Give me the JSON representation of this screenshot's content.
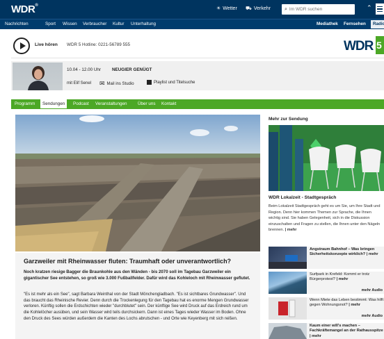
{
  "header": {
    "logo": "WDR",
    "weather": "Wetter",
    "traffic": "Verkehr",
    "search_placeholder": "Im WDR suchen",
    "nav_left": [
      "Nachrichten",
      "Sport",
      "Wissen",
      "Verbraucher",
      "Kultur",
      "Unterhaltung"
    ],
    "nav_right": [
      "Mediathek",
      "Fernsehen",
      "Radio"
    ]
  },
  "player": {
    "live_label": "Live hören",
    "hotline": "WDR 5 Hotline: 0221-56789 555",
    "station_text": "WDR",
    "station_number": "5"
  },
  "show": {
    "time": "10.04 - 12.00 Uhr",
    "name": "NEUGIER GENÜGT",
    "host": "mit Elif Senel",
    "mail": "Mail ins Studio",
    "playlist": "Playlist und Titelsuche"
  },
  "tabs": [
    "Programm",
    "Sendungen",
    "Podcast",
    "Veranstaltungen",
    "Über uns",
    "Kontakt"
  ],
  "article": {
    "title": "Garzweiler mit Rheinwasser fluten: Traumhaft oder unverantwortlich?",
    "lead": "Noch kratzen riesige Bagger die Braunkohle aus den Wänden - bis 2070 soll im Tagebau Garzweiler ein gigantischer See entstehen, so groß wie 3.000 Fußballfelder. Dafür wird das Kohleloch mit Rheinwasser geflutet.",
    "body": "\"Es ist mehr als ein See\", sagt Barbara Weinthal von der Stadt Mönchengladbach. \"Es ist sichtbares Grundwasser\". Und das braucht das Rheinische Revier. Denn durch die Trockenlegung für den Tagebau hat es enorme Mengen Grundwasser verloren. Künftig sollen die Erdschichten wieder \"durchblutet\" sein. Der künftige See wird Druck auf das Erdreich rund um die Kohlelöcher ausüben, und sein Wasser wird teils durchsickern. Dann ist eines Tages wieder Wasser im Boden. Ohne den Druck des Sees würden außerdem die Kanten des Lochs abrutschen - und Orte wie Keyenberg mit sich reißen."
  },
  "sidebar": {
    "heading": "Mehr zur Sendung",
    "feature_title": "WDR Lokalzeit - Stadtgespräch",
    "feature_text": "Beim Lokalzeit Stadtgespräch geht es um Sie, um Ihre Stadt und Region. Denn hier kommen Themen zur Sprache, die Ihnen wichtig sind. Sie haben Gelegenheit, sich in die Diskussion einzuschalten und Fragen zu stellen, die Ihnen unter den Nägeln brennen.",
    "feature_more": "| mehr",
    "items": [
      {
        "text": "Angstraum Bahnhof – Was bringen Sicherheitskonzepte wirklich?",
        "more": "| mehr"
      },
      {
        "text": "Surfpark in Krefeld: Kommt er trotz Bürgerprotest?",
        "more": "| mehr",
        "more2": "mehr Audio"
      },
      {
        "text": "Wenn Miete das Leben bestimmt: Was hilft gegen Wohnungsnot?",
        "more": "| mehr",
        "more2": "mehr Audio"
      },
      {
        "text": "Kaum einer will's machen – Fachkräftemangel an der Rathausspitze",
        "more": "| mehr"
      }
    ]
  }
}
